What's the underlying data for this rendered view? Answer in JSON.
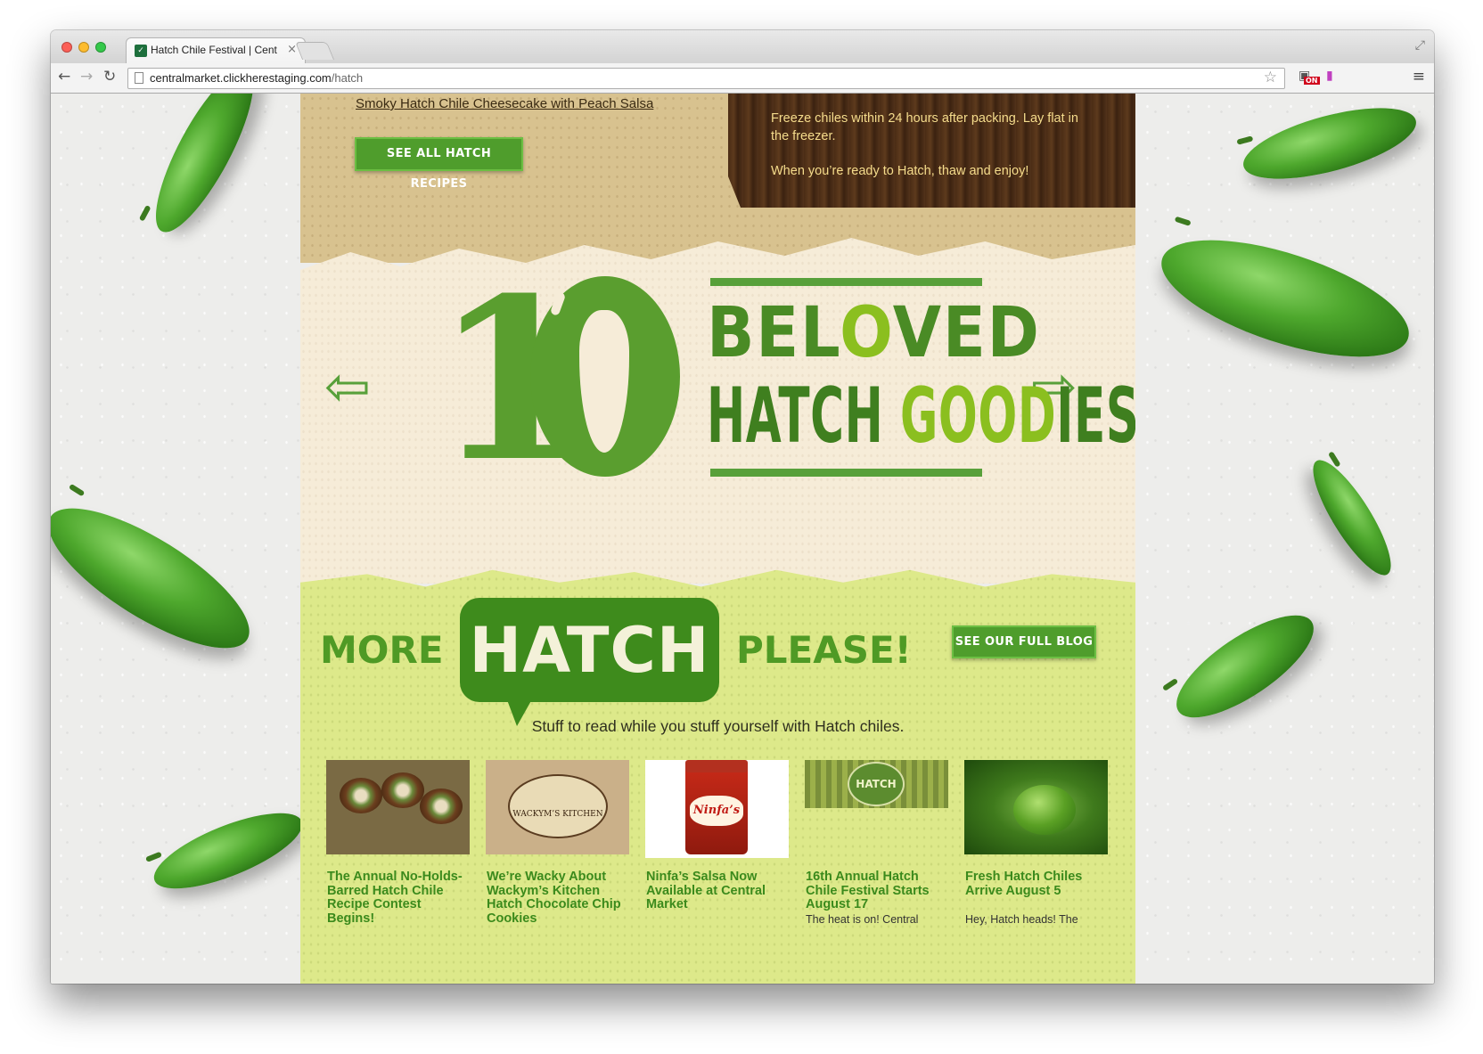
{
  "browser": {
    "tab_title": "Hatch Chile Festival | Cent",
    "tab_close": "×",
    "url_host": "centralmarket.clickherestaging.com",
    "url_path": "/hatch",
    "ext_badge": "ON"
  },
  "top_section": {
    "recipe_link": "Smoky Hatch Chile Cheesecake with Peach Salsa",
    "see_all_recipes_button": "SEE ALL HATCH RECIPES",
    "freeze_tip_1": "Freeze chiles within 24 hours after packing. Lay flat in the freezer.",
    "freeze_tip_2": "When you’re ready to Hatch, thaw and enjoy!"
  },
  "goodies_banner": {
    "number_one": "1",
    "line_1_dark": "BEL",
    "line_1_light": "O",
    "line_1_dark2": "VED",
    "line_2_dark": "HATCH ",
    "line_2_light": "GOOD",
    "line_2_dark2": "IES"
  },
  "blog_section": {
    "more_word": "MORE",
    "hatch_word": "HATCH",
    "please_word": "PLEASE!",
    "see_full_blog_button": "SEE OUR FULL BLOG",
    "tagline": "Stuff to read while you stuff yourself with Hatch chiles.",
    "posts": [
      {
        "title": "The Annual No-Holds-Barred Hatch Chile Recipe Contest Begins!",
        "excerpt": ""
      },
      {
        "title": "We’re Wacky About Wackym’s Kitchen Hatch Chocolate Chip Cookies",
        "excerpt": "",
        "thumb_text": "WACKYM’S KITCHEN"
      },
      {
        "title": "Ninfa’s Salsa Now Available at Central Market",
        "excerpt": "",
        "thumb_text": "Ninfa’s"
      },
      {
        "title": "16th Annual Hatch Chile Festival Starts August 17",
        "excerpt": "The heat is on! Central",
        "thumb_text": "HATCH"
      },
      {
        "title": "Fresh Hatch Chiles Arrive August 5",
        "excerpt": "Hey, Hatch heads! The"
      }
    ]
  },
  "colors": {
    "brand_green": "#4f9d2c",
    "dark_green": "#3e8b1c",
    "lime_background": "#dde98a",
    "cream_background": "#f6ecd8",
    "kraft_background": "#d8c28f",
    "wood": "#4a2c15",
    "wood_text": "#f5dc8c"
  },
  "icons": [
    "back-arrow-icon",
    "forward-arrow-icon",
    "reload-icon",
    "page-icon",
    "star-icon",
    "extension-icon",
    "menu-icon",
    "fullscreen-icon",
    "prev-arrow-icon",
    "next-arrow-icon",
    "chile-icon"
  ]
}
